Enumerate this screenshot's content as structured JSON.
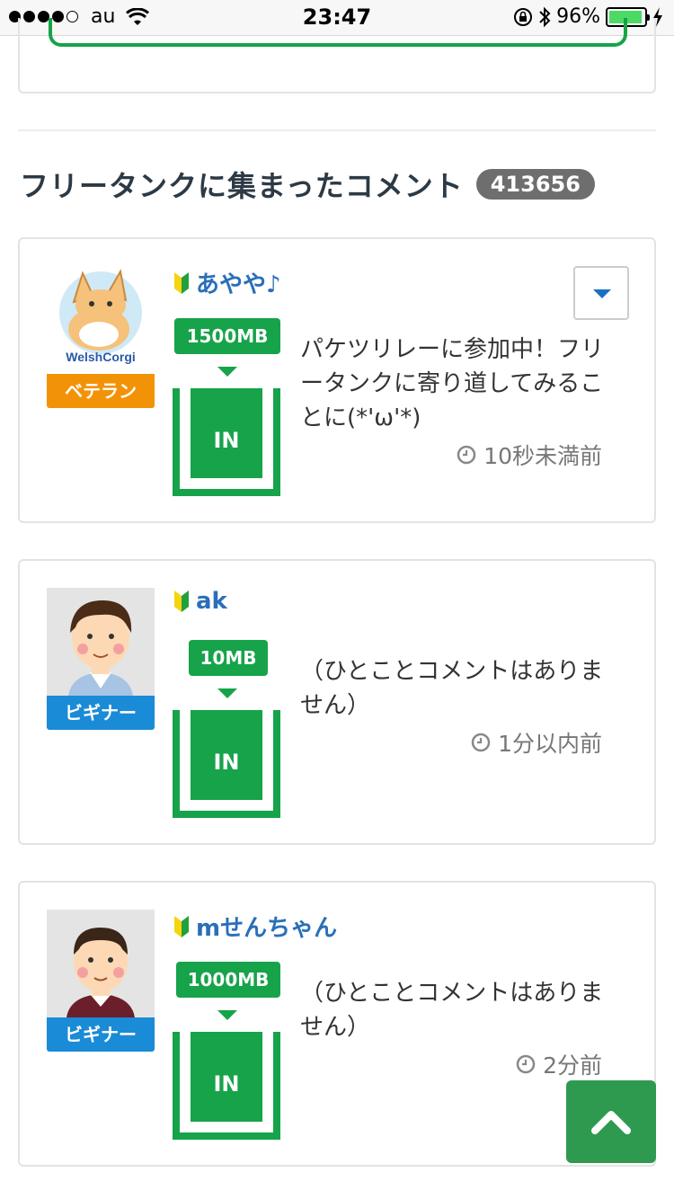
{
  "status_bar": {
    "carrier": "au",
    "time": "23:47",
    "battery": "96%",
    "battery_level": 0.96,
    "colors": {
      "battery": "#4cd964"
    }
  },
  "section": {
    "title": "フリータンクに集まったコメント",
    "count": "413656"
  },
  "comments": [
    {
      "username": "あやや♪",
      "rank": "ベテラン",
      "amount": "1500MB",
      "tank_label": "IN",
      "comment": "パケツリレーに参加中！フリータンクに寄り道してみることに(*'ω'*)",
      "time": "10秒未満前",
      "avatar_text": "WelshCorgi"
    },
    {
      "username": "ak",
      "rank": "ビギナー",
      "amount": "10MB",
      "tank_label": "IN",
      "comment": "（ひとことコメントはありません）",
      "time": "1分以内前"
    },
    {
      "username": "mせんちゃん",
      "rank": "ビギナー",
      "amount": "1000MB",
      "tank_label": "IN",
      "comment": "（ひとことコメントはありません）",
      "time": "2分前"
    }
  ],
  "icons": {
    "beginner": "beginner-leaf-icon",
    "clock": "clock-icon",
    "dropdown": "caret-down-icon",
    "back_to_top": "chevron-up-icon"
  },
  "colors": {
    "accent_green": "#16a34a",
    "link_blue": "#2a6fb8",
    "veteran": "#f29307",
    "beginner": "#1a8bd6"
  }
}
